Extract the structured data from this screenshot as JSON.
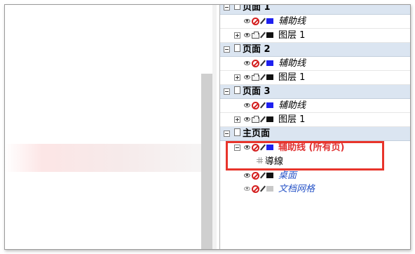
{
  "colors": {
    "guides_blue": "#1e20f0",
    "layer_black": "#111111",
    "grid_gray": "#c8c8c8",
    "highlight_red": "#e8342b",
    "master_guides_text": "#e03030",
    "desktop_text": "#2a56c8",
    "page_header_bg": "#dbe5f1"
  },
  "layers_panel": {
    "pages": [
      {
        "title": "页面 1",
        "layers": [
          {
            "name": "辅助线",
            "style": "italic",
            "swatch": "blue"
          },
          {
            "name": "图层 1",
            "style": "normal",
            "swatch": "black"
          }
        ]
      },
      {
        "title": "页面 2",
        "layers": [
          {
            "name": "辅助线",
            "style": "italic",
            "swatch": "blue"
          },
          {
            "name": "图层 1",
            "style": "normal",
            "swatch": "black"
          }
        ]
      },
      {
        "title": "页面 3",
        "layers": [
          {
            "name": "辅助线",
            "style": "italic",
            "swatch": "blue"
          },
          {
            "name": "图层 1",
            "style": "normal",
            "swatch": "black"
          }
        ]
      }
    ],
    "master_page": {
      "title": "主页面",
      "layers": [
        {
          "name": "辅助线 (所有页)",
          "style": "bold",
          "swatch": "blue",
          "sub_items": [
            "導線"
          ]
        },
        {
          "name": "桌面",
          "style": "italic",
          "swatch": "black"
        },
        {
          "name": "文档网格",
          "style": "italic",
          "swatch": "gray"
        }
      ]
    }
  },
  "icons": [
    "eye-icon",
    "no-print-icon",
    "printer-icon",
    "pencil-icon",
    "color-swatch",
    "page-icon",
    "expander-icon",
    "guide-object-icon"
  ]
}
